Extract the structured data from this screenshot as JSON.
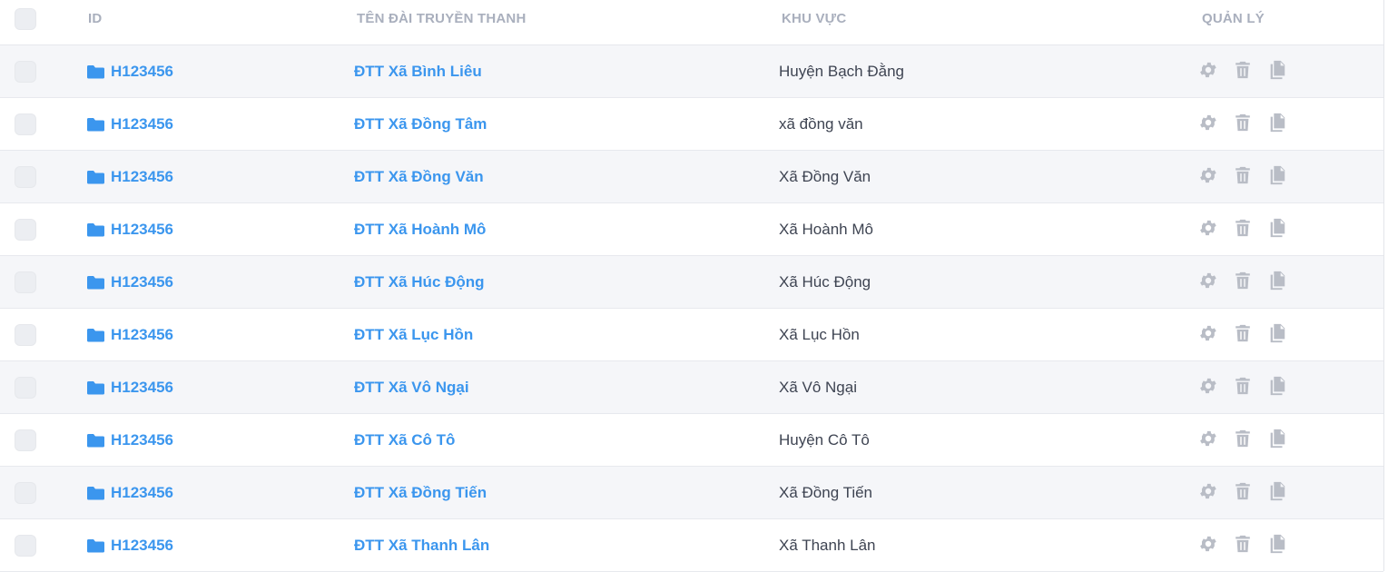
{
  "colors": {
    "link": "#3b96ee",
    "icon": "#b9bdc6",
    "text": "#3e4452",
    "header": "#a9afbd"
  },
  "header": {
    "id": "ID",
    "name": "TÊN ĐÀI TRUYỀN THANH",
    "area": "KHU VỰC",
    "manage": "QUẢN LÝ"
  },
  "rows": [
    {
      "id": "H123456",
      "name": "ĐTT Xã Bình Liêu",
      "area": "Huyện Bạch Đằng"
    },
    {
      "id": "H123456",
      "name": "ĐTT Xã Đồng Tâm",
      "area": "xã đồng văn"
    },
    {
      "id": "H123456",
      "name": "ĐTT Xã Đồng Văn",
      "area": "Xã Đồng Văn"
    },
    {
      "id": "H123456",
      "name": "ĐTT Xã Hoành Mô",
      "area": "Xã Hoành Mô"
    },
    {
      "id": "H123456",
      "name": "ĐTT Xã Húc Động",
      "area": "Xã Húc Động"
    },
    {
      "id": "H123456",
      "name": "ĐTT Xã Lục Hồn",
      "area": "Xã Lục Hồn"
    },
    {
      "id": "H123456",
      "name": "ĐTT Xã Vô Ngại",
      "area": "Xã Vô Ngại"
    },
    {
      "id": "H123456",
      "name": "ĐTT Xã Cô Tô",
      "area": "Huyện Cô Tô"
    },
    {
      "id": "H123456",
      "name": "ĐTT Xã Đồng Tiến",
      "area": "Xã Đồng Tiến"
    },
    {
      "id": "H123456",
      "name": "ĐTT Xã Thanh Lân",
      "area": "Xã Thanh Lân"
    }
  ],
  "icons": {
    "folder": "folder-icon",
    "settings": "gear-icon",
    "delete": "trash-icon",
    "copy": "copy-icon"
  }
}
